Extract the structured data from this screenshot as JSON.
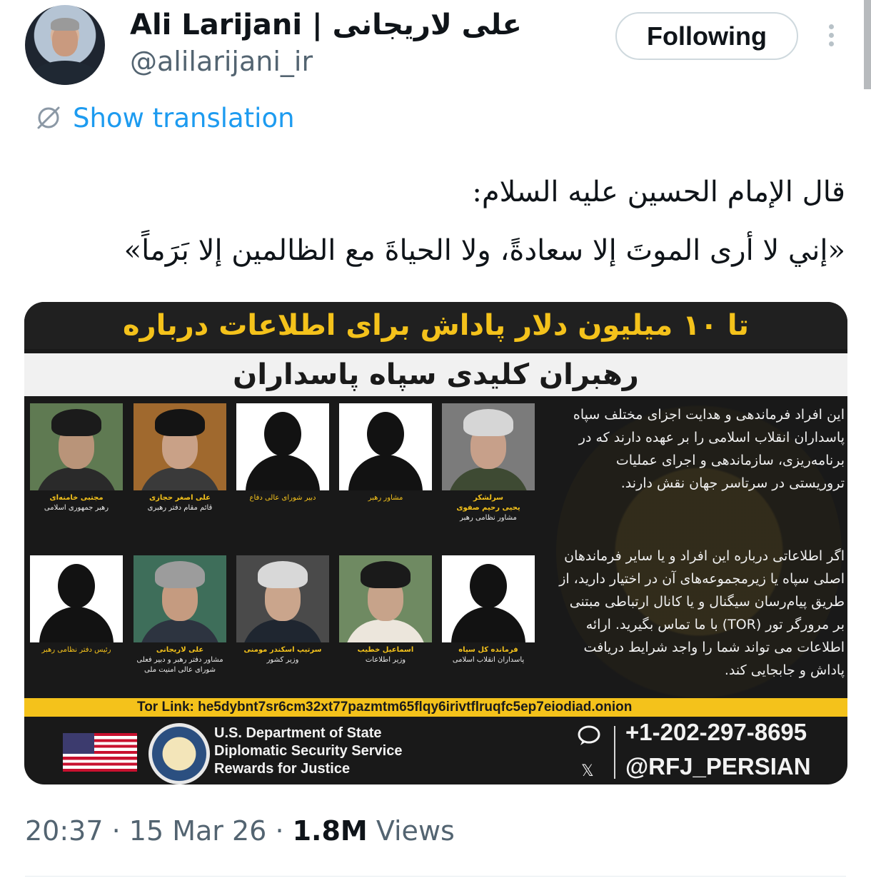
{
  "author": {
    "display_name": "Ali Larijani | علی لاریجانی",
    "handle": "@alilarijani_ir"
  },
  "actions": {
    "follow_label": "Following",
    "more_icon": "more-vertical-icon"
  },
  "translation": {
    "label": "Show translation",
    "icon": "translate-icon"
  },
  "tweet": {
    "line1": "قال الإمام الحسين عليه السلام:",
    "line2": "«إني لا أرى الموتَ إلا سعادةً، ولا الحياةَ مع الظالمين إلا بَرَماً»"
  },
  "poster": {
    "headline": "تا ۱۰ میلیون دلار پاداش برای اطلاعات درباره",
    "subhead": "رهبران کلیدی سپاه پاسداران",
    "cards_row1": [
      {
        "name": "مجتبی خامنه‌ای",
        "role": "رهبر جمهوری اسلامی",
        "kind": "person",
        "face": "#b99479",
        "top": "#1b1b1b",
        "body": "#2a2a2a",
        "bg": "#5f7a52"
      },
      {
        "name": "علی اصغر حجازی",
        "role": "قائم مقام دفتر رهبری",
        "kind": "person",
        "face": "#c9a187",
        "top": "#141414",
        "body": "#3a3a3a",
        "bg": "#a0692e"
      },
      {
        "name": "",
        "role": "دبیر شورای عالی دفاع",
        "kind": "silhouette"
      },
      {
        "name": "",
        "role": "مشاور رهبر",
        "kind": "silhouette"
      },
      {
        "name": "سرلشکر\nیحیی رحیم صفوی",
        "role": "مشاور نظامی رهبر",
        "kind": "person",
        "face": "#c7a08a",
        "top": "#d6d6d6",
        "body": "#3e4a33",
        "bg": "#7b7b7b"
      }
    ],
    "cards_row2": [
      {
        "name": "",
        "role": "رئیس دفتر نظامی رهبر",
        "kind": "silhouette"
      },
      {
        "name": "علی لاریجانی",
        "role": "مشاور دفتر رهبر و دبیر فعلی شورای عالی امنیت ملی",
        "kind": "person",
        "face": "#c59b80",
        "top": "#9c9c9c",
        "body": "#2d3440",
        "bg": "#3e6e5a"
      },
      {
        "name": "سرتیپ اسکندر مومنی",
        "role": "وزیر کشور",
        "kind": "person",
        "face": "#caa58c",
        "top": "#d8d8d8",
        "body": "#1f2630",
        "bg": "#4a4a4a"
      },
      {
        "name": "اسماعیل خطیب",
        "role": "وزیر اطلاعات",
        "kind": "person",
        "face": "#c7a38a",
        "top": "#1a1a1a",
        "body": "#ece6dc",
        "bg": "#6f8a62"
      },
      {
        "name": "فرمانده کل سپاه",
        "role": "پاسداران انقلاب اسلامی",
        "kind": "silhouette"
      }
    ],
    "side_text_1": "این افراد فرماندهی و هدایت اجزای مختلف سپاه پاسداران انقلاب اسلامی را بر عهده دارند که در برنامه‌ریزی، سازماندهی و اجرای عملیات تروریستی در سرتاسر جهان نقش دارند.",
    "side_text_2": "اگر اطلاعاتی درباره این افراد و یا سایر فرماندهان اصلی سپاه یا زیرمجموعه‌های آن در اختیار دارید، از طریق پیام‌رسان سیگنال و یا کانال ارتباطی مبتنی بر مرورگر تور (TOR) با ما تماس بگیرید. ارائه اطلاعات می تواند شما را واجد شرایط دریافت پاداش و جابجایی کند.",
    "tor_link": "Tor Link: he5dybnt7sr6cm32xt77pazmtm65flqy6irivtflruqfc5ep7eiodiad.onion",
    "agency_lines": [
      "U.S. Department of State",
      "Diplomatic Security Service",
      "Rewards for Justice"
    ],
    "phone": "+1-202-297-8695",
    "social": "@RFJ_PERSIAN",
    "colors": {
      "accent_yellow": "#f4c21b",
      "background": "#191919"
    }
  },
  "meta": {
    "time": "20:37",
    "date": "15 Mar 26",
    "views_count": "1.8M",
    "views_label": "Views"
  },
  "colors": {
    "link_blue": "#1d9bf0",
    "secondary_text": "#536471"
  }
}
